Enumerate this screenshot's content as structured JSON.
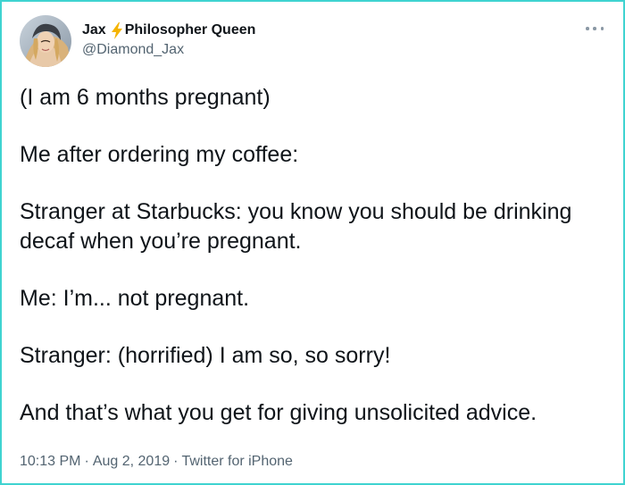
{
  "tweet": {
    "author": {
      "name_first": "Jax",
      "name_last": "Philosopher Queen",
      "emoji_icon": "lightning-bolt-icon",
      "handle": "@Diamond_Jax"
    },
    "menu_icon": "more-dots-icon",
    "paragraphs": [
      "(I am 6 months pregnant)",
      "Me after ordering my coffee:",
      "Stranger at Starbucks: you know you should be drinking decaf when you’re pregnant.",
      "Me: I’m... not pregnant.",
      "Stranger: (horrified) I am so, so sorry!",
      "And that’s what you get for giving unsolicited advice."
    ],
    "time": "10:13 PM",
    "date": "Aug 2, 2019",
    "source": "Twitter for iPhone",
    "separator": "·"
  },
  "colors": {
    "border": "#3fd3d0",
    "text_primary": "#0f1419",
    "text_secondary": "#536471",
    "bolt": "#f5b400"
  }
}
